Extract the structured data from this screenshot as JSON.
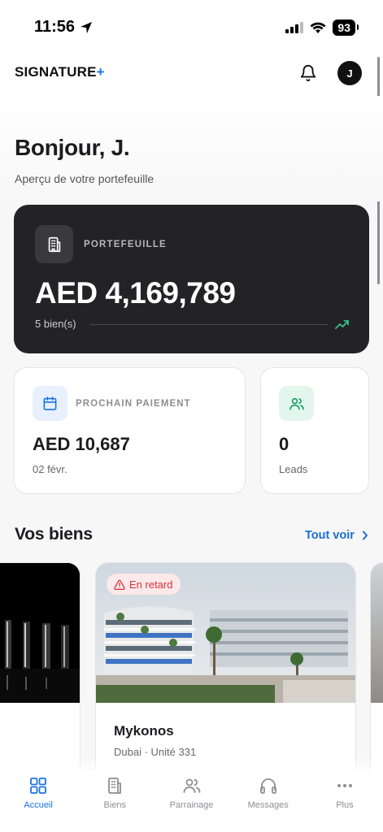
{
  "status_bar": {
    "time": "11:56",
    "battery": "93"
  },
  "header": {
    "logo_text": "SIGNATURE",
    "logo_plus": "+",
    "avatar_initial": "J"
  },
  "greeting": {
    "title": "Bonjour, J.",
    "subtitle": "Aperçu de votre portefeuille"
  },
  "portfolio": {
    "label": "PORTEFEUILLE",
    "value": "AED 4,169,789",
    "count": "5 bien(s)"
  },
  "payment": {
    "label": "PROCHAIN PAIEMENT",
    "value": "AED 10,687",
    "date": "02 févr."
  },
  "leads": {
    "value": "0",
    "label": "Leads"
  },
  "properties": {
    "title": "Vos biens",
    "see_all": "Tout voir",
    "featured": {
      "badge": "En retard",
      "name": "Mykonos",
      "location": "Dubai · Unité 331"
    }
  },
  "tabs": [
    {
      "label": "Accueil",
      "icon": "grid-icon",
      "active": true
    },
    {
      "label": "Biens",
      "icon": "building-icon",
      "active": false
    },
    {
      "label": "Parrainage",
      "icon": "users-icon",
      "active": false
    },
    {
      "label": "Messages",
      "icon": "headphones-icon",
      "active": false
    },
    {
      "label": "Plus",
      "icon": "more-icon",
      "active": false
    }
  ],
  "colors": {
    "accent": "#1a73e8",
    "dark_card": "#232325",
    "alert": "#d93037",
    "trend": "#34c28a"
  }
}
